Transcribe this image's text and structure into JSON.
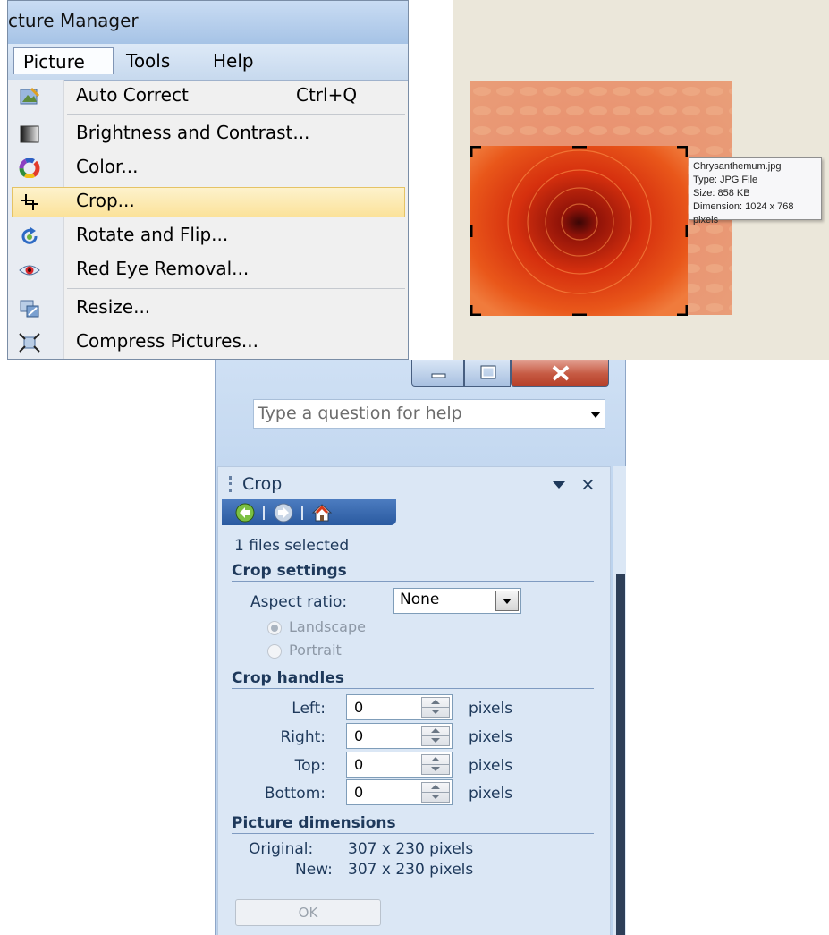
{
  "app_title": "cture Manager",
  "menu_bar": {
    "picture": "Picture",
    "tools": "Tools",
    "help": "Help"
  },
  "picture_menu": {
    "items": [
      {
        "label": "Auto Correct",
        "shortcut": "Ctrl+Q",
        "icon": "auto-correct-icon"
      },
      {
        "label": "Brightness and Contrast...",
        "icon": "brightness-contrast-icon"
      },
      {
        "label": "Color...",
        "icon": "color-wheel-icon"
      },
      {
        "label": "Crop...",
        "icon": "crop-icon",
        "highlighted": true
      },
      {
        "label": "Rotate and Flip...",
        "icon": "rotate-flip-icon"
      },
      {
        "label": "Red Eye Removal...",
        "icon": "red-eye-icon"
      },
      {
        "label": "Resize...",
        "icon": "resize-icon"
      },
      {
        "label": "Compress Pictures...",
        "icon": "compress-icon"
      }
    ]
  },
  "tooltip": {
    "name": "Chrysanthemum.jpg",
    "type": "Type: JPG File",
    "size": "Size: 858 KB",
    "dimension": "Dimension: 1024 x 768 pixels"
  },
  "help_search": {
    "placeholder": "Type a question for help"
  },
  "crop_pane": {
    "title": "Crop",
    "files_selected": "1 files selected",
    "crop_settings": {
      "heading": "Crop settings",
      "aspect_label": "Aspect ratio:",
      "aspect_value": "None",
      "landscape": "Landscape",
      "portrait": "Portrait"
    },
    "crop_handles": {
      "heading": "Crop handles",
      "unit": "pixels",
      "fields": [
        {
          "label": "Left:",
          "value": "0"
        },
        {
          "label": "Right:",
          "value": "0"
        },
        {
          "label": "Top:",
          "value": "0"
        },
        {
          "label": "Bottom:",
          "value": "0"
        }
      ]
    },
    "dimensions": {
      "heading": "Picture dimensions",
      "original_label": "Original:",
      "original_value": "307 x 230 pixels",
      "new_label": "New:",
      "new_value": "307 x 230 pixels"
    },
    "ok_label": "OK"
  },
  "colors": {
    "menu_highlight": "#fbe29a",
    "pane_background": "#dbe7f5",
    "pane_text": "#1e395b",
    "nav_bar": "#2a5aa0",
    "close_button": "#c65a43"
  }
}
